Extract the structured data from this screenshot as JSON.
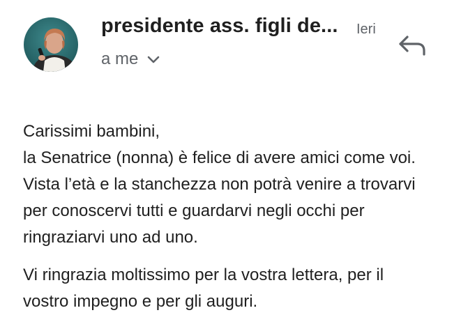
{
  "header": {
    "sender": "presidente ass. figli de...",
    "time": "Ieri",
    "recipient": "a me",
    "avatar": "sender-photo",
    "reply_icon": "reply-arrow-icon",
    "expand_icon": "chevron-down-icon"
  },
  "message": {
    "paragraphs": [
      {
        "lines": [
          "Carissimi bambini,",
          "la Senatrice (nonna) è felice di avere amici come voi.",
          "Vista l’età e la stanchezza non potrà venire a trovarvi",
          "per conoscervi tutti e guardarvi negli occhi per",
          "ringraziarvi uno ad uno."
        ]
      },
      {
        "lines": [
          "Vi ringrazia moltissimo per la vostra lettera, per il",
          "vostro impegno e per gli auguri."
        ]
      }
    ]
  },
  "colors": {
    "avatar_bg": "#2e6f73",
    "text": "#1f1f1f",
    "secondary": "#5f6368"
  }
}
